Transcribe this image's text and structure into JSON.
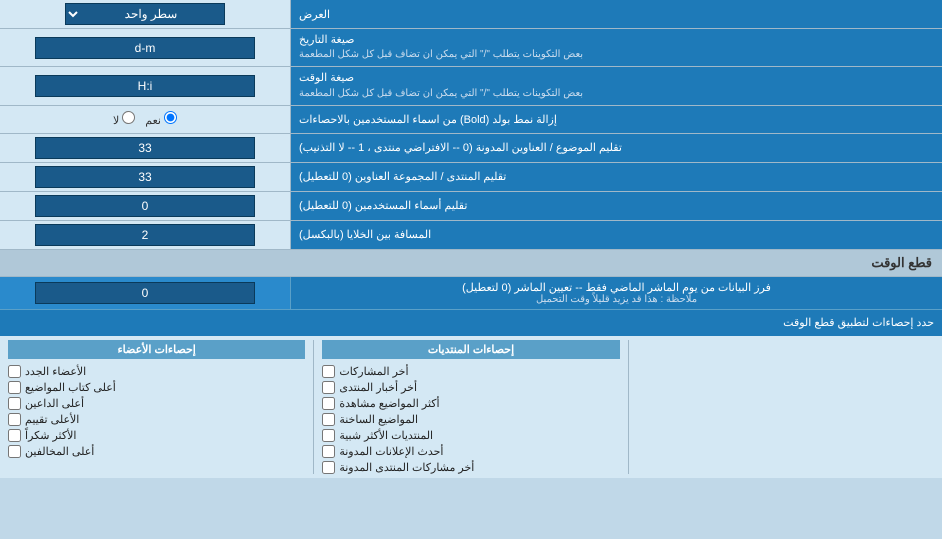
{
  "page": {
    "title": "العرض"
  },
  "rows": [
    {
      "id": "display-row",
      "label": "العرض",
      "type": "select",
      "value": "سطر واحد"
    },
    {
      "id": "date-format",
      "label": "صيغة التاريخ",
      "sublabel": "بعض التكوينات يتطلب \"/\" التي يمكن ان تضاف قبل كل شكل المطعمة",
      "type": "input",
      "value": "d-m"
    },
    {
      "id": "time-format",
      "label": "صيغة الوقت",
      "sublabel": "بعض التكوينات يتطلب \"/\" التي يمكن ان تضاف قبل كل شكل المطعمة",
      "type": "input",
      "value": "H:i"
    },
    {
      "id": "bold-remove",
      "label": "إزالة نمط بولد (Bold) من اسماء المستخدمين بالاحصاءات",
      "type": "radio",
      "options": [
        "نعم",
        "لا"
      ],
      "selected": "نعم"
    },
    {
      "id": "topic-title-trim",
      "label": "تقليم الموضوع / العناوين المدونة (0 -- الافتراضي منتدى ، 1 -- لا التذنيب)",
      "type": "input",
      "value": "33"
    },
    {
      "id": "forum-group-trim",
      "label": "تقليم المنتدى / المجموعة العناوين (0 للتعطيل)",
      "type": "input",
      "value": "33"
    },
    {
      "id": "username-trim",
      "label": "تقليم أسماء المستخدمين (0 للتعطيل)",
      "type": "input",
      "value": "0"
    },
    {
      "id": "cell-spacing",
      "label": "المسافة بين الخلايا (بالبكسل)",
      "type": "input",
      "value": "2"
    }
  ],
  "section_cutoff": {
    "title": "قطع الوقت",
    "row": {
      "label": "فرز البيانات من يوم الماشر الماضي فقط -- تعيين الماشر (0 لتعطيل)",
      "note": "ملاحظة : هذا قد يزيد قليلاً وقت التحميل",
      "value": "0"
    },
    "checkbox_header": "حدد إحصاءات لتطبيق قطع الوقت"
  },
  "columns": {
    "col1_header": "",
    "col2_header": "إحصاءات المنتديات",
    "col3_header": "إحصاءات الأعضاء"
  },
  "checkboxes": {
    "col2": [
      "أخر المشاركات",
      "أخر أخبار المنتدى",
      "أكثر المواضيع مشاهدة",
      "المواضيع الساخنة",
      "المنتديات الأكثر شبية",
      "أحدث الإعلانات المدونة",
      "أخر مشاركات المنتدى المدونة"
    ],
    "col3": [
      "الأعضاء الجدد",
      "أعلى كتاب المواضيع",
      "أعلى الداعين",
      "الأعلى تقييم",
      "الأكثر شكراً",
      "أعلى المخالفين"
    ]
  },
  "labels": {
    "display_select": "سطر واحد",
    "yes": "نعم",
    "no": "لا"
  }
}
